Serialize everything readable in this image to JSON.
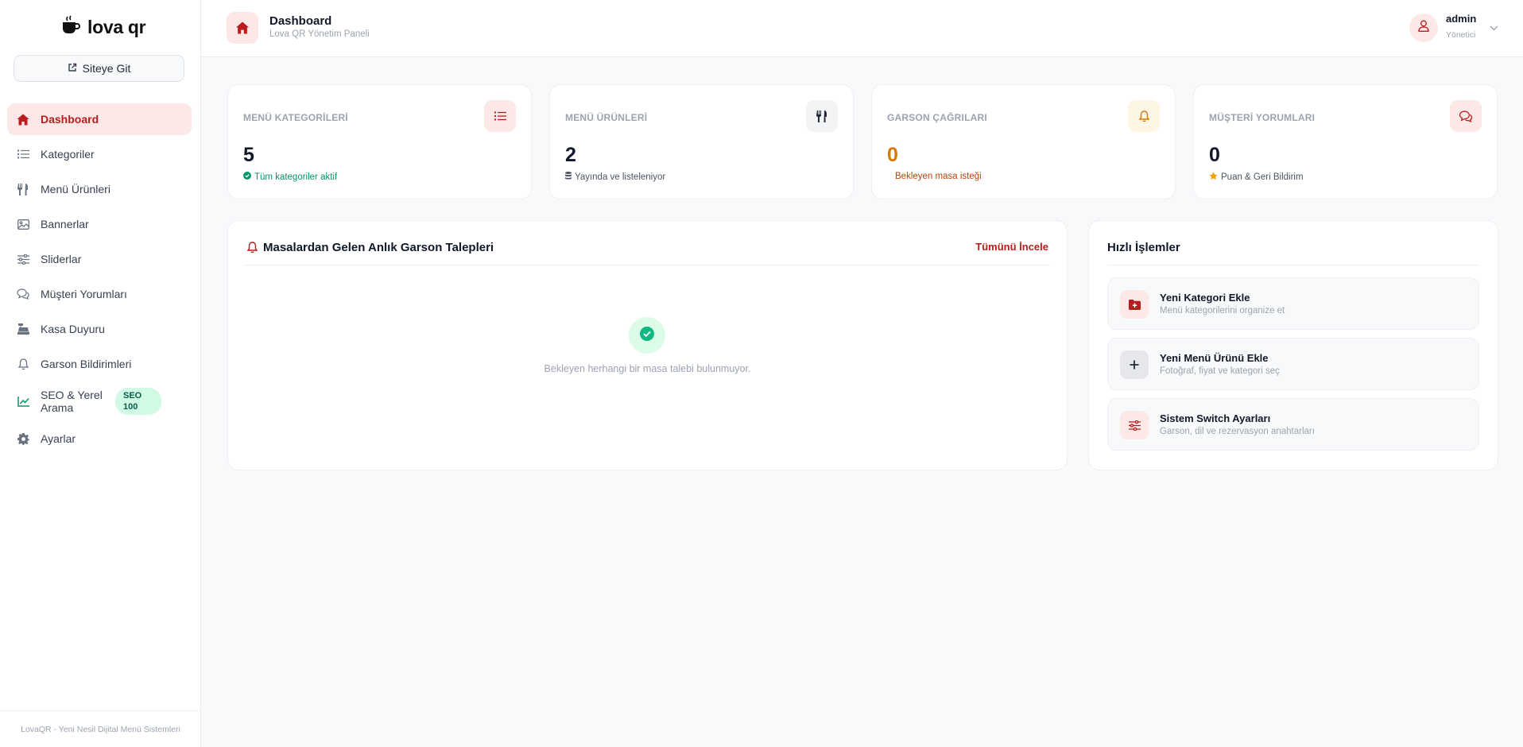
{
  "sidebar": {
    "logo_text": "lova qr",
    "site_button": "Siteye Git",
    "items": [
      {
        "label": "Dashboard",
        "icon": "home-icon"
      },
      {
        "label": "Kategoriler",
        "icon": "list-icon"
      },
      {
        "label": "Menü Ürünleri",
        "icon": "utensils-icon"
      },
      {
        "label": "Bannerlar",
        "icon": "image-icon"
      },
      {
        "label": "Sliderlar",
        "icon": "sliders-icon"
      },
      {
        "label": "Müşteri Yorumları",
        "icon": "comments-icon"
      },
      {
        "label": "Kasa Duyuru",
        "icon": "cash-register-icon"
      },
      {
        "label": "Garson Bildirimleri",
        "icon": "bell-icon"
      },
      {
        "label": "SEO & Yerel Arama",
        "icon": "chart-line-icon",
        "badge": "SEO 100"
      },
      {
        "label": "Ayarlar",
        "icon": "gear-icon"
      }
    ],
    "footer": "LovaQR - Yeni Nesil Dijital Menü Sistemleri"
  },
  "header": {
    "title": "Dashboard",
    "subtitle": "Lova QR Yönetim Paneli",
    "user_name": "admin",
    "user_role": "Yönetici"
  },
  "stats": [
    {
      "title": "MENÜ KATEGORİLERİ",
      "value": "5",
      "sub": "Tüm kategoriler aktif",
      "value_color": "#111827",
      "sub_color": "#059669",
      "icon": "list-icon"
    },
    {
      "title": "MENÜ ÜRÜNLERİ",
      "value": "2",
      "sub": "Yayında ve listeleniyor",
      "value_color": "#111827",
      "sub_color": "#4b5563",
      "icon": "utensils-icon"
    },
    {
      "title": "GARSON ÇAĞRILARI",
      "value": "0",
      "sub": "Bekleyen masa isteği",
      "value_color": "#d97706",
      "sub_color": "#c2410c",
      "icon": "bell-icon"
    },
    {
      "title": "MÜŞTERİ YORUMLARI",
      "value": "0",
      "sub": "Puan & Geri Bildirim",
      "value_color": "#111827",
      "sub_color": "#4b5563",
      "icon": "comments-icon"
    }
  ],
  "requests_panel": {
    "title": "Masalardan Gelen Anlık Garson Talepleri",
    "link": "Tümünü İncele",
    "empty_text": "Bekleyen herhangi bir masa talebi bulunmuyor."
  },
  "quick_actions": {
    "title": "Hızlı İşlemler",
    "items": [
      {
        "title": "Yeni Kategori Ekle",
        "sub": "Menü kategorilerini organize et",
        "icon": "folder-plus-icon"
      },
      {
        "title": "Yeni Menü Ürünü Ekle",
        "sub": "Fotoğraf, fiyat ve kategori seç",
        "icon": "plus-icon"
      },
      {
        "title": "Sistem Switch Ayarları",
        "sub": "Garson, dil ve rezervasyon anahtarları",
        "icon": "sliders-icon"
      }
    ]
  },
  "colors": {
    "accent": "#b91c1c",
    "accent_soft": "#fde8e8",
    "success": "#059669",
    "warning": "#d97706"
  }
}
